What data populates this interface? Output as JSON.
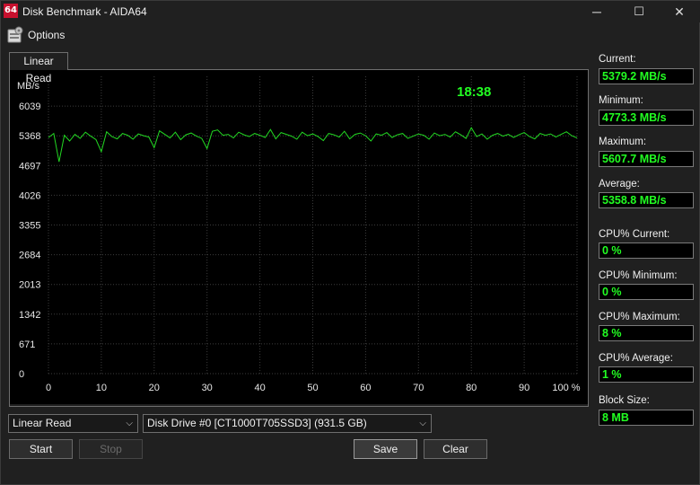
{
  "window": {
    "title": "Disk Benchmark - AIDA64",
    "app_icon_text": "64",
    "minimize_glyph": "─",
    "maximize_glyph": "☐",
    "close_glyph": "✕"
  },
  "menu": {
    "options_label": "Options",
    "options_icon": "options-icon"
  },
  "tab": {
    "label": "Linear Read"
  },
  "chart_data": {
    "type": "line",
    "ylabel": "MB/s",
    "y_ticks": [
      "6039",
      "5368",
      "4697",
      "4026",
      "3355",
      "2684",
      "2013",
      "1342",
      "671",
      "0"
    ],
    "ylim": [
      0,
      6710
    ],
    "x_ticks": [
      "0",
      "10",
      "20",
      "30",
      "40",
      "50",
      "60",
      "70",
      "80",
      "90",
      "100 %"
    ],
    "xlim": [
      0,
      100
    ],
    "timer": "18:38",
    "grid": true,
    "series": [
      {
        "color": "#22d822",
        "x": [
          0,
          1,
          2,
          3,
          4,
          5,
          6,
          7,
          8,
          9,
          10,
          11,
          12,
          13,
          14,
          15,
          16,
          17,
          18,
          19,
          20,
          21,
          22,
          23,
          24,
          25,
          26,
          27,
          28,
          29,
          30,
          31,
          32,
          33,
          34,
          35,
          36,
          37,
          38,
          39,
          40,
          41,
          42,
          43,
          44,
          45,
          46,
          47,
          48,
          49,
          50,
          51,
          52,
          53,
          54,
          55,
          56,
          57,
          58,
          59,
          60,
          61,
          62,
          63,
          64,
          65,
          66,
          67,
          68,
          69,
          70,
          71,
          72,
          73,
          74,
          75,
          76,
          77,
          78,
          79,
          80,
          81,
          82,
          83,
          84,
          85,
          86,
          87,
          88,
          89,
          90,
          91,
          92,
          93,
          94,
          95,
          96,
          97,
          98,
          99,
          100
        ],
        "y": [
          5330,
          5420,
          4780,
          5380,
          5250,
          5400,
          5310,
          5450,
          5360,
          5280,
          5010,
          5460,
          5350,
          5300,
          5420,
          5380,
          5290,
          5410,
          5370,
          5340,
          5100,
          5480,
          5400,
          5320,
          5450,
          5280,
          5390,
          5430,
          5360,
          5310,
          5080,
          5470,
          5500,
          5380,
          5400,
          5320,
          5450,
          5390,
          5350,
          5420,
          5380,
          5330,
          5510,
          5300,
          5440,
          5400,
          5360,
          5290,
          5450,
          5370,
          5410,
          5350,
          5260,
          5420,
          5390,
          5340,
          5470,
          5300,
          5400,
          5430,
          5370,
          5250,
          5410,
          5380,
          5440,
          5330,
          5390,
          5420,
          5310,
          5360,
          5410,
          5380,
          5290,
          5430,
          5370,
          5400,
          5340,
          5460,
          5390,
          5310,
          5550,
          5350,
          5410,
          5290,
          5380,
          5420,
          5360,
          5400,
          5330,
          5390,
          5440,
          5350,
          5300,
          5420,
          5380,
          5410,
          5340,
          5400,
          5460,
          5370,
          5320
        ]
      }
    ]
  },
  "stats": {
    "current_label": "Current:",
    "current_value": "5379.2 MB/s",
    "minimum_label": "Minimum:",
    "minimum_value": "4773.3 MB/s",
    "maximum_label": "Maximum:",
    "maximum_value": "5607.7 MB/s",
    "average_label": "Average:",
    "average_value": "5358.8 MB/s",
    "cpu_current_label": "CPU% Current:",
    "cpu_current_value": "0 %",
    "cpu_minimum_label": "CPU% Minimum:",
    "cpu_minimum_value": "0 %",
    "cpu_maximum_label": "CPU% Maximum:",
    "cpu_maximum_value": "8 %",
    "cpu_average_label": "CPU% Average:",
    "cpu_average_value": "1 %",
    "block_size_label": "Block Size:",
    "block_size_value": "8 MB"
  },
  "controls": {
    "test_select": "Linear Read",
    "drive_select": "Disk Drive #0  [CT1000T705SSD3]  (931.5 GB)",
    "dropdown_glyph": "⌵",
    "start_label": "Start",
    "stop_label": "Stop",
    "save_label": "Save",
    "clear_label": "Clear"
  }
}
